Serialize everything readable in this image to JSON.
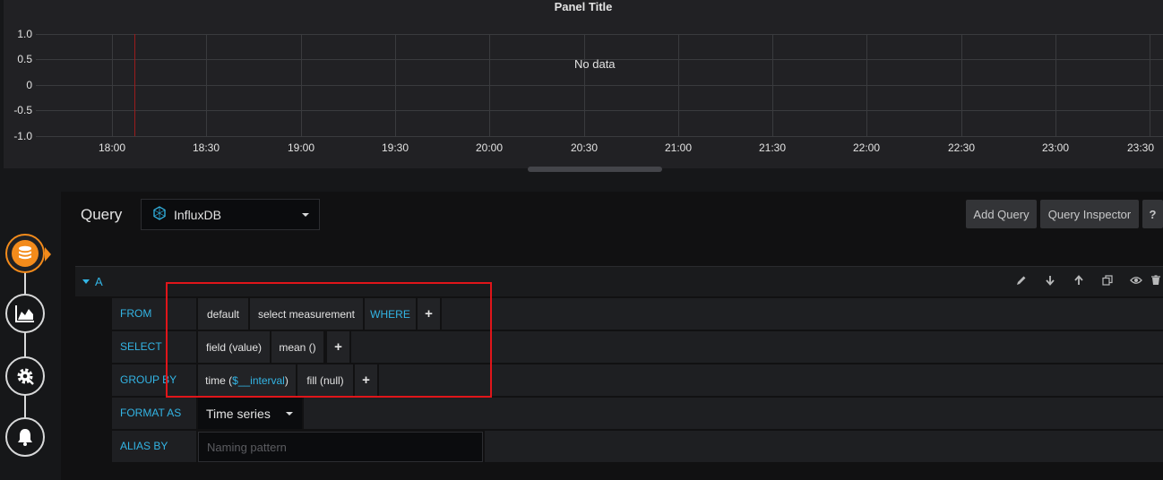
{
  "panel": {
    "title": "Panel Title",
    "no_data": "No data",
    "y_ticks": [
      "1.0",
      "0.5",
      "0",
      "-0.5",
      "-1.0"
    ],
    "x_ticks": [
      "18:00",
      "18:30",
      "19:00",
      "19:30",
      "20:00",
      "20:30",
      "21:00",
      "21:30",
      "22:00",
      "22:30",
      "23:00",
      "23:30"
    ]
  },
  "sidebar": {
    "items": [
      {
        "name": "queries",
        "icon": "database-icon",
        "active": true
      },
      {
        "name": "visualization",
        "icon": "area-chart-icon",
        "active": false
      },
      {
        "name": "general",
        "icon": "gear-icon",
        "active": false
      },
      {
        "name": "alert",
        "icon": "bell-icon",
        "active": false
      }
    ]
  },
  "query": {
    "title": "Query",
    "datasource": "InfluxDB",
    "add_query": "Add Query",
    "query_inspector": "Query Inspector",
    "help": "?",
    "row_letter": "A",
    "rows": {
      "from": {
        "label": "FROM",
        "policy": "default",
        "measurement": "select measurement",
        "where": "WHERE",
        "plus": "+"
      },
      "select": {
        "label": "SELECT",
        "field": "field (value)",
        "func": "mean ()",
        "plus": "+"
      },
      "group_by": {
        "label": "GROUP BY",
        "time_prefix": "time (",
        "time_var": "$__interval",
        "time_suffix": ")",
        "fill": "fill (null)",
        "plus": "+"
      },
      "format_as": {
        "label": "FORMAT AS",
        "value": "Time series"
      },
      "alias_by": {
        "label": "ALIAS BY",
        "placeholder": "Naming pattern"
      }
    }
  },
  "colors": {
    "accent": "#33b5e5",
    "active": "#f38b1b",
    "highlight_box": "#e0151a"
  }
}
